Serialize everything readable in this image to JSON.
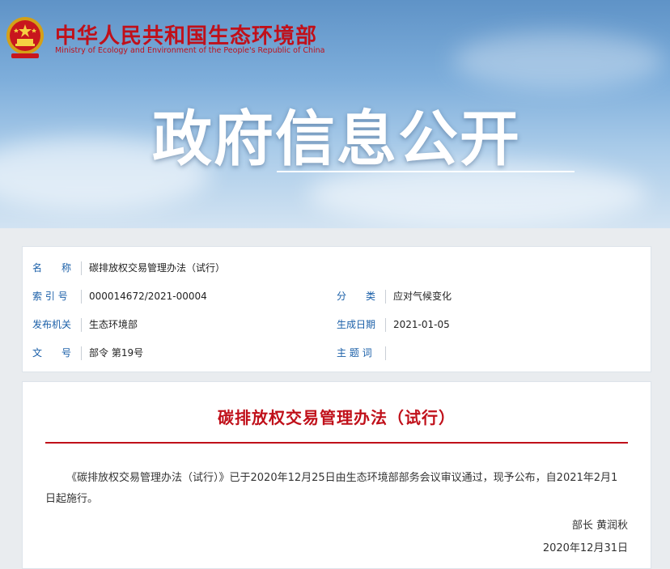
{
  "header": {
    "site_title": "中华人民共和国生态环境部",
    "site_subtitle": "Ministry of Ecology and Environment of the People's Republic of China",
    "banner_title": "政府信息公开",
    "emblem_icon": "national-emblem-icon"
  },
  "meta": {
    "name_label": "名　　称",
    "name_value": "碳排放权交易管理办法（试行）",
    "index_label": "索 引 号",
    "index_value": "000014672/2021-00004",
    "category_label": "分　　类",
    "category_value": "应对气候变化",
    "issuer_label": "发布机关",
    "issuer_value": "生态环境部",
    "date_label": "生成日期",
    "date_value": "2021-01-05",
    "docno_label": "文　　号",
    "docno_value": "部令 第19号",
    "subject_label": "主 题 词",
    "subject_value": ""
  },
  "document": {
    "title": "碳排放权交易管理办法（试行）",
    "body": "《碳排放权交易管理办法（试行）》已于2020年12月25日由生态环境部部务会议审议通过，现予公布，自2021年2月1日起施行。",
    "signer": "部长  黄润秋",
    "sign_date": "2020年12月31日"
  },
  "colors": {
    "brand_red": "#c0101a",
    "label_blue": "#1a5fa8"
  }
}
